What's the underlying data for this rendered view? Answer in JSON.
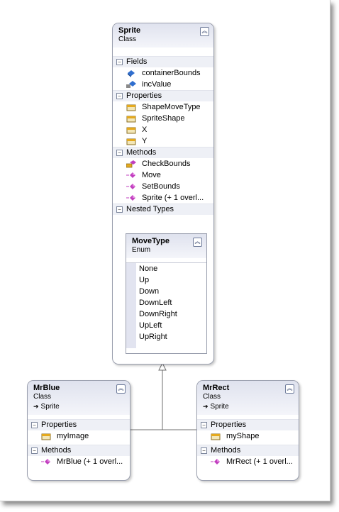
{
  "sprite": {
    "title": "Sprite",
    "kind": "Class",
    "fields_header": "Fields",
    "fields": [
      {
        "label": "containerBounds",
        "icon": "field-icon"
      },
      {
        "label": "incValue",
        "icon": "private-field-icon"
      }
    ],
    "properties_header": "Properties",
    "properties": [
      {
        "label": "ShapeMoveType",
        "icon": "property-icon"
      },
      {
        "label": "SpriteShape",
        "icon": "property-icon"
      },
      {
        "label": "X",
        "icon": "property-icon"
      },
      {
        "label": "Y",
        "icon": "property-icon"
      }
    ],
    "methods_header": "Methods",
    "methods": [
      {
        "label": "CheckBounds",
        "icon": "protected-method-icon"
      },
      {
        "label": "Move",
        "icon": "method-icon"
      },
      {
        "label": "SetBounds",
        "icon": "method-icon"
      },
      {
        "label": "Sprite (+ 1 overl...",
        "icon": "method-icon"
      }
    ],
    "nested_header": "Nested Types"
  },
  "move_type": {
    "title": "MoveType",
    "kind": "Enum",
    "values": [
      "None",
      "Up",
      "Down",
      "DownLeft",
      "DownRight",
      "UpLeft",
      "UpRight"
    ]
  },
  "mr_blue": {
    "title": "MrBlue",
    "kind": "Class",
    "base": "Sprite",
    "properties_header": "Properties",
    "properties": [
      {
        "label": "myImage",
        "icon": "property-icon"
      }
    ],
    "methods_header": "Methods",
    "methods": [
      {
        "label": "MrBlue (+ 1 overl...",
        "icon": "method-icon"
      }
    ]
  },
  "mr_rect": {
    "title": "MrRect",
    "kind": "Class",
    "base": "Sprite",
    "properties_header": "Properties",
    "properties": [
      {
        "label": "myShape",
        "icon": "property-icon"
      }
    ],
    "methods_header": "Methods",
    "methods": [
      {
        "label": "MrRect (+ 1 overl...",
        "icon": "method-icon"
      }
    ]
  },
  "colors": {
    "header_gradient_top": "#dfe2ee",
    "section_bg": "#eef0f6",
    "border": "#9a9fae",
    "field_blue": "#2f6ecf",
    "property_gold": "#e5a91d",
    "method_magenta": "#c23fbf"
  }
}
